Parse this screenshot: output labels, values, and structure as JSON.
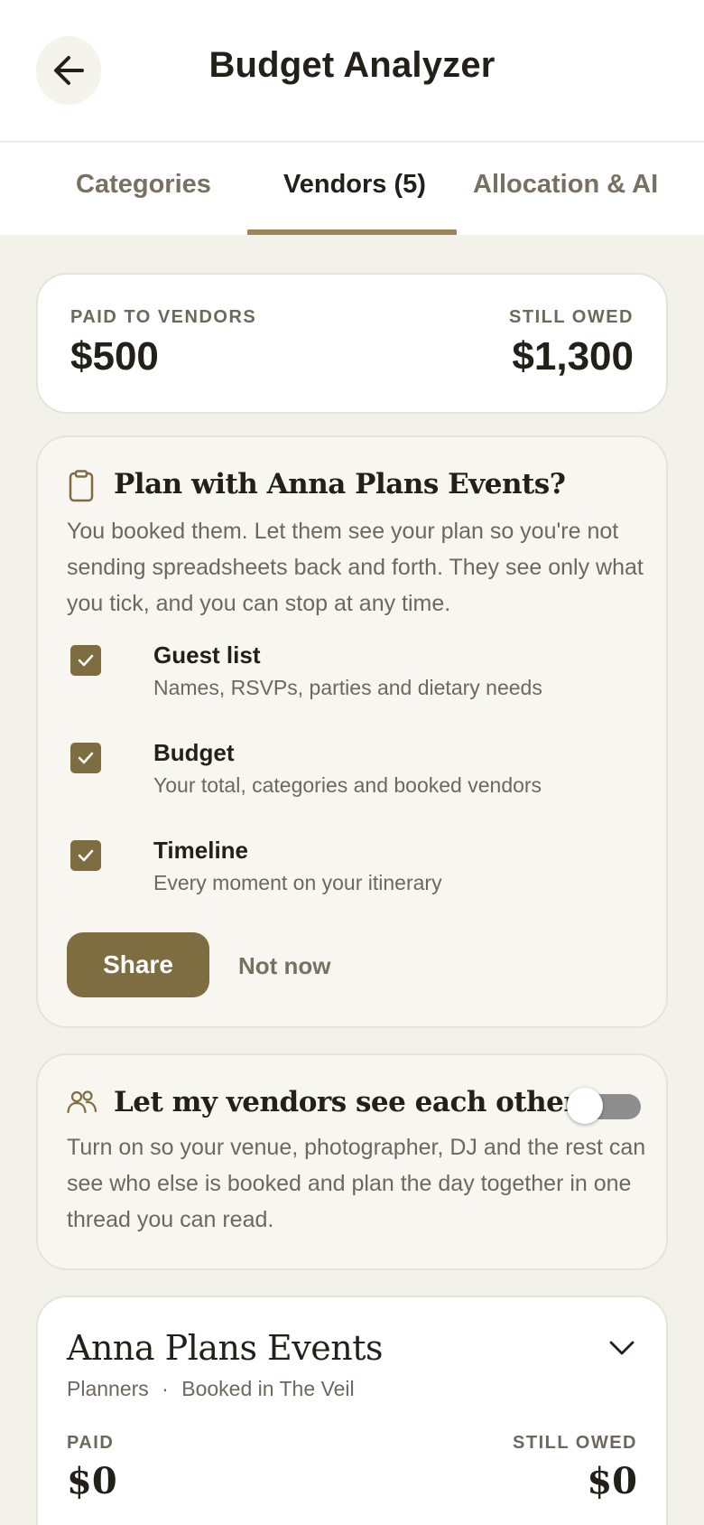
{
  "header": {
    "title": "Budget Analyzer",
    "back_icon": "arrow-left-icon"
  },
  "tabs": [
    {
      "label": "Categories",
      "active": false
    },
    {
      "label": "Vendors (5)",
      "active": true
    },
    {
      "label": "Allocation & AI",
      "active": false
    }
  ],
  "summary": {
    "paid_label": "PAID TO VENDORS",
    "paid_value": "$500",
    "owed_label": "STILL OWED",
    "owed_value": "$1,300"
  },
  "share_card": {
    "icon": "clipboard-icon",
    "title": "Plan with Anna Plans Events?",
    "body": "You booked them. Let them see your plan so you're not sending spreadsheets back and forth. They see only what you tick, and you can stop at any time.",
    "options": [
      {
        "title": "Guest list",
        "desc": "Names, RSVPs, parties and dietary needs",
        "checked": true
      },
      {
        "title": "Budget",
        "desc": "Your total, categories and booked vendors",
        "checked": true
      },
      {
        "title": "Timeline",
        "desc": "Every moment on your itinerary",
        "checked": true
      }
    ],
    "share_label": "Share",
    "dismiss_label": "Not now"
  },
  "vendors_visibility": {
    "icon": "users-icon",
    "title": "Let my vendors see each other",
    "enabled": false,
    "body": "Turn on so your venue, photographer, DJ and the rest can see who else is booked and plan the day together in one thread you can read."
  },
  "vendor": {
    "name": "Anna Plans Events",
    "category": "Planners",
    "separator": "·",
    "booked_in": "Booked in The Veil",
    "paid_label": "PAID",
    "paid_value": "$0",
    "owed_label": "STILL OWED",
    "owed_value": "$0"
  },
  "colors": {
    "accent": "#7f6d42",
    "tab_indicator": "#9a8558",
    "background": "#f2f2ea",
    "muted_text": "#6e685c"
  }
}
